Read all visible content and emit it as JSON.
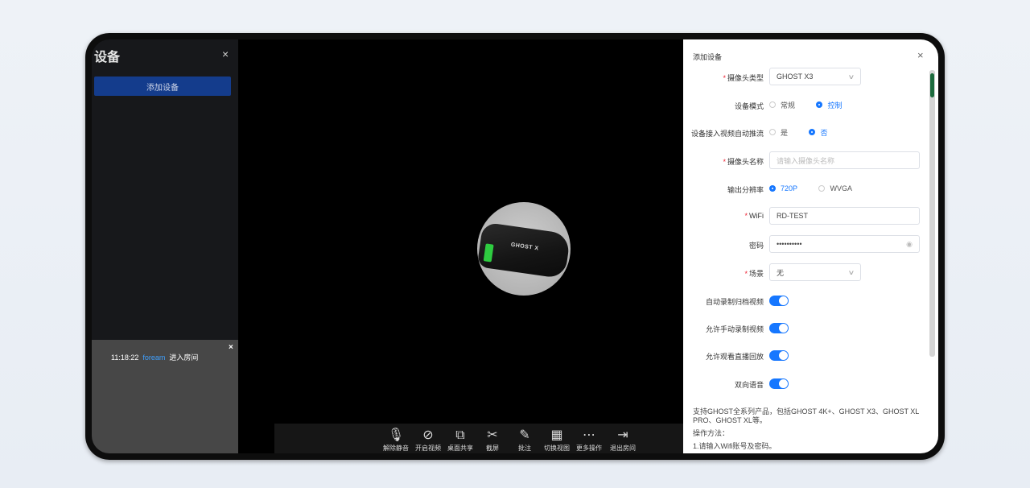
{
  "sidebar": {
    "title": "设备",
    "close": "×",
    "add_button": "添加设备"
  },
  "chat": {
    "close": "×",
    "time": "11:18:22",
    "user": "foream",
    "message": "进入房间"
  },
  "camera_preview": {
    "label": "GHOST X"
  },
  "toolbar": [
    {
      "icon": "mic-off-icon",
      "glyph": "🎙",
      "label": "解除静音"
    },
    {
      "icon": "video-off-icon",
      "glyph": "⊘",
      "label": "开启视频"
    },
    {
      "icon": "screen-share-icon",
      "glyph": "⧉",
      "label": "桌面共享"
    },
    {
      "icon": "screenshot-icon",
      "glyph": "✂",
      "label": "截屏"
    },
    {
      "icon": "annotate-icon",
      "glyph": "✎",
      "label": "批注"
    },
    {
      "icon": "grid-view-icon",
      "glyph": "▦",
      "label": "切换视图"
    },
    {
      "icon": "more-icon",
      "glyph": "⋯",
      "label": "更多操作"
    },
    {
      "icon": "exit-icon",
      "glyph": "⇥",
      "label": "退出房间"
    }
  ],
  "dialog": {
    "title": "添加设备",
    "close": "×",
    "fields": {
      "camera_type": {
        "label": "摄像头类型",
        "value": "GHOST X3"
      },
      "device_mode": {
        "label": "设备模式",
        "options": [
          "常规",
          "控制"
        ],
        "selected": "控制"
      },
      "auto_push": {
        "label": "设备接入视频自动推流",
        "options": [
          "是",
          "否"
        ],
        "selected": "否"
      },
      "camera_name": {
        "label": "摄像头名称",
        "placeholder": "请输入摄像头名称"
      },
      "resolution": {
        "label": "输出分辨率",
        "options": [
          "720P",
          "WVGA"
        ],
        "selected": "720P"
      },
      "wifi": {
        "label": "WiFi",
        "value": "RD-TEST"
      },
      "password": {
        "label": "密码",
        "value": "••••••••••"
      },
      "scene": {
        "label": "场景",
        "value": "无"
      },
      "auto_record": {
        "label": "自动录制归档视频",
        "on": true
      },
      "manual_record": {
        "label": "允许手动录制视频",
        "on": true
      },
      "live_replay": {
        "label": "允许观看直播回放",
        "on": true
      },
      "two_way_audio": {
        "label": "双向语音",
        "on": true
      }
    },
    "description": [
      "支持GHOST全系列产品，包括GHOST 4K+、GHOST X3、GHOST XL PRO、GHOST XL等。",
      "操作方法：",
      "1.请输入Wifi账号及密码。"
    ]
  }
}
